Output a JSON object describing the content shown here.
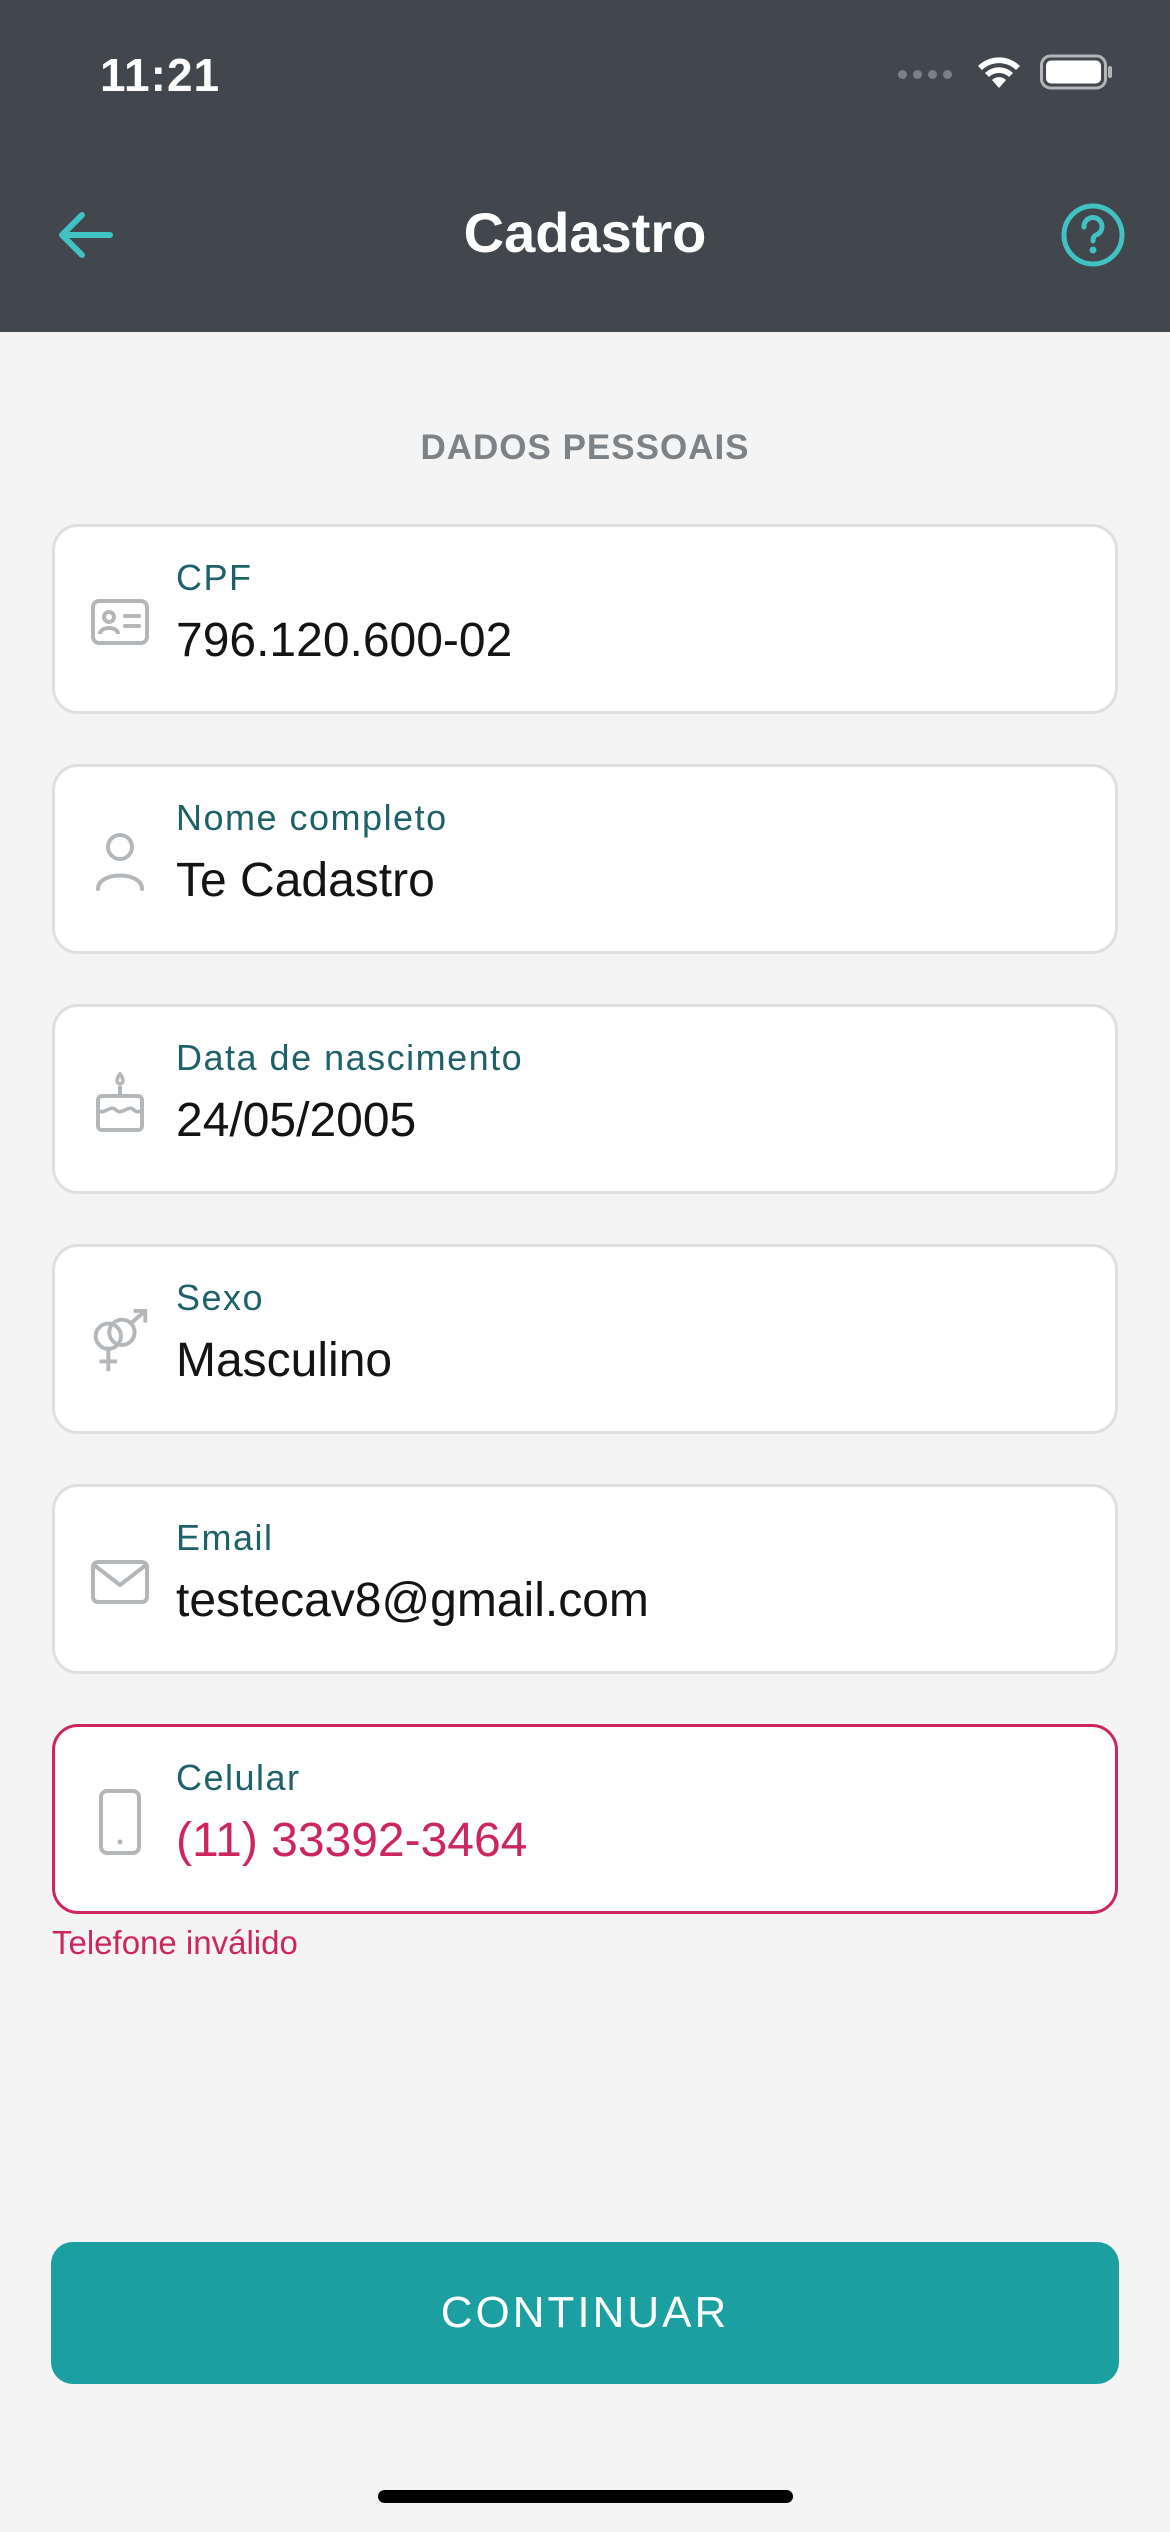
{
  "status_bar": {
    "time": "11:21"
  },
  "nav": {
    "title": "Cadastro",
    "back_icon": "arrow-left-icon",
    "help_icon": "question-circle-icon"
  },
  "section": {
    "title": "DADOS PESSOAIS"
  },
  "fields": [
    {
      "label": "CPF",
      "value": "796.120.600-02",
      "icon": "id-card-icon"
    },
    {
      "label": "Nome completo",
      "value": "Te Cadastro",
      "icon": "user-icon"
    },
    {
      "label": "Data de nascimento",
      "value": "24/05/2005",
      "icon": "cake-icon"
    },
    {
      "label": "Sexo",
      "value": "Masculino",
      "icon": "gender-icon"
    },
    {
      "label": "Email",
      "value": "testecav8@gmail.com",
      "icon": "envelope-icon"
    },
    {
      "label": "Celular",
      "value": "(11) 33392-3464",
      "icon": "phone-icon",
      "error": "Telefone inválido"
    }
  ],
  "actions": {
    "continue_label": "CONTINUAR"
  },
  "colors": {
    "header_bg": "#41474c",
    "accent": "#40c1c4",
    "button": "#1b9fa1",
    "error": "#cd2560",
    "label": "#1e6168",
    "page_bg": "#f4f4f5"
  }
}
